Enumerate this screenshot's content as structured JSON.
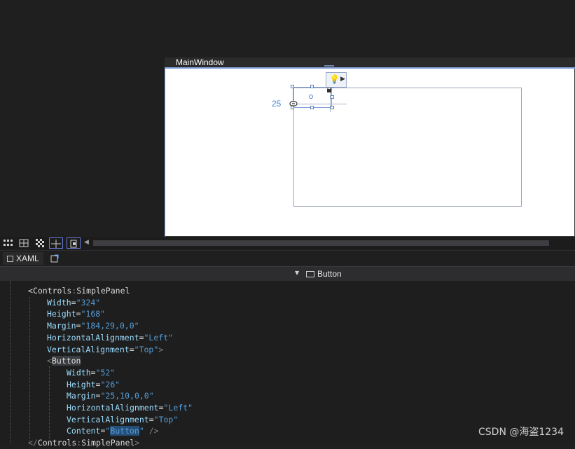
{
  "designer": {
    "window_title": "MainWindow",
    "margin_value": "25"
  },
  "toolbar": {
    "icons": [
      "grid-icon",
      "snap-grid-icon",
      "checkerboard-icon",
      "snapline-icon",
      "effects-icon"
    ]
  },
  "tabs": {
    "xaml_label": "XAML"
  },
  "nav": {
    "selected_element": "Button"
  },
  "code": {
    "lines": [
      {
        "indent": 0,
        "parts": [
          [
            "tag",
            "<"
          ],
          [
            "tag",
            "Controls"
          ],
          [
            "punct",
            ":"
          ],
          [
            "tag",
            "SimplePanel"
          ]
        ]
      },
      {
        "indent": 1,
        "parts": [
          [
            "attr",
            "Width"
          ],
          [
            "eq",
            "="
          ],
          [
            "val",
            "\"324\""
          ]
        ]
      },
      {
        "indent": 1,
        "parts": [
          [
            "attr",
            "Height"
          ],
          [
            "eq",
            "="
          ],
          [
            "val",
            "\"168\""
          ]
        ]
      },
      {
        "indent": 1,
        "parts": [
          [
            "attr",
            "Margin"
          ],
          [
            "eq",
            "="
          ],
          [
            "val",
            "\"184,29,0,0\""
          ]
        ]
      },
      {
        "indent": 1,
        "parts": [
          [
            "attr",
            "HorizontalAlignment"
          ],
          [
            "eq",
            "="
          ],
          [
            "val",
            "\"Left\""
          ]
        ]
      },
      {
        "indent": 1,
        "parts": [
          [
            "attr",
            "VerticalAlignment"
          ],
          [
            "eq",
            "="
          ],
          [
            "val",
            "\"Top\""
          ],
          [
            "punct",
            ">"
          ]
        ]
      },
      {
        "indent": 1,
        "parts": [
          [
            "punct",
            "<"
          ],
          [
            "taghl",
            "Button"
          ]
        ]
      },
      {
        "indent": 2,
        "parts": [
          [
            "attr",
            "Width"
          ],
          [
            "eq",
            "="
          ],
          [
            "val",
            "\"52\""
          ]
        ]
      },
      {
        "indent": 2,
        "parts": [
          [
            "attr",
            "Height"
          ],
          [
            "eq",
            "="
          ],
          [
            "val",
            "\"26\""
          ]
        ]
      },
      {
        "indent": 2,
        "parts": [
          [
            "attr",
            "Margin"
          ],
          [
            "eq",
            "="
          ],
          [
            "val",
            "\"25,10,0,0\""
          ]
        ]
      },
      {
        "indent": 2,
        "parts": [
          [
            "attr",
            "HorizontalAlignment"
          ],
          [
            "eq",
            "="
          ],
          [
            "val",
            "\"Left\""
          ]
        ]
      },
      {
        "indent": 2,
        "parts": [
          [
            "attr",
            "VerticalAlignment"
          ],
          [
            "eq",
            "="
          ],
          [
            "val",
            "\"Top\""
          ]
        ]
      },
      {
        "indent": 2,
        "parts": [
          [
            "attr",
            "Content"
          ],
          [
            "eq",
            "="
          ],
          [
            "val",
            "\""
          ],
          [
            "valhl",
            "Button"
          ],
          [
            "val",
            "\""
          ],
          [
            "punct",
            " />"
          ]
        ]
      },
      {
        "indent": 0,
        "parts": [
          [
            "punct",
            "</"
          ],
          [
            "tag",
            "Controls"
          ],
          [
            "punct",
            ":"
          ],
          [
            "tag",
            "SimplePanel"
          ],
          [
            "punct",
            ">"
          ]
        ]
      }
    ]
  },
  "watermark": "CSDN @海盗1234"
}
